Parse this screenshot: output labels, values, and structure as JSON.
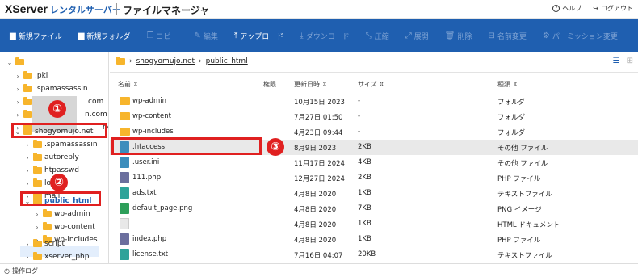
{
  "header": {
    "logo": "XServer",
    "logo_sub": "レンタルサーバー",
    "app_title": "ファイルマネージャ",
    "help_label": "ヘルプ",
    "logout_label": "ログアウト"
  },
  "toolbar": {
    "new_file": "新規ファイル",
    "new_folder": "新規フォルダ",
    "copy": "コピー",
    "edit": "編集",
    "upload": "アップロード",
    "download": "ダウンロード",
    "compress": "圧縮",
    "extract": "展開",
    "delete": "削除",
    "rename": "名前変更",
    "permission": "パーミッション変更"
  },
  "tree": {
    "pki": ".pki",
    "spamassassin": ".spamassassin",
    "site1_suffix": "com",
    "site2_suffix": "n.com",
    "site3_suffix": "ne",
    "shogyomujo": "shogyomujo.net",
    "sub_spamassassin": ".spamassassin",
    "autoreply": "autoreply",
    "htpasswd": "htpasswd",
    "log": "log",
    "mail": "mail",
    "public_html": "public_html",
    "wp_admin": "wp-admin",
    "wp_content": "wp-content",
    "wp_includes": "wp-includes",
    "script": "script",
    "xserver_php": "xserver_php"
  },
  "annotations": {
    "n1": "①",
    "n2": "②",
    "n3": "③"
  },
  "breadcrumb": {
    "domain": "shogyomujo.net",
    "folder": "public_html"
  },
  "columns": {
    "name": "名前",
    "perm": "権限",
    "date": "更新日時",
    "size": "サイズ",
    "type": "種類"
  },
  "files": [
    {
      "name": "wp-admin",
      "date": "10月15日 2023",
      "size": "-",
      "type": "フォルダ"
    },
    {
      "name": "wp-content",
      "date": "7月27日 01:50",
      "size": "-",
      "type": "フォルダ"
    },
    {
      "name": "wp-includes",
      "date": "4月23日 09:44",
      "size": "-",
      "type": "フォルダ"
    },
    {
      "name": ".htaccess",
      "date": "8月9日 2023",
      "size": "2KB",
      "type": "その他 ファイル"
    },
    {
      "name": ".user.ini",
      "date": "11月17日 2024",
      "size": "4KB",
      "type": "その他 ファイル"
    },
    {
      "name": "111.php",
      "date": "12月27日 2024",
      "size": "2KB",
      "type": "PHP ファイル"
    },
    {
      "name": "ads.txt",
      "date": "4月8日 2020",
      "size": "1KB",
      "type": "テキストファイル"
    },
    {
      "name": "default_page.png",
      "date": "4月8日 2020",
      "size": "7KB",
      "type": "PNG イメージ"
    },
    {
      "name": "",
      "date": "4月8日 2020",
      "size": "1KB",
      "type": "HTML ドキュメント"
    },
    {
      "name": "index.php",
      "date": "4月8日 2020",
      "size": "1KB",
      "type": "PHP ファイル"
    },
    {
      "name": "license.txt",
      "date": "7月16日 04:07",
      "size": "20KB",
      "type": "テキストファイル"
    }
  ],
  "footer": {
    "log_label": "操作ログ"
  },
  "colors": {
    "toolbar_bg": "#1f5fb0",
    "annotation_red": "#e02020",
    "folder": "#f7b52c"
  }
}
